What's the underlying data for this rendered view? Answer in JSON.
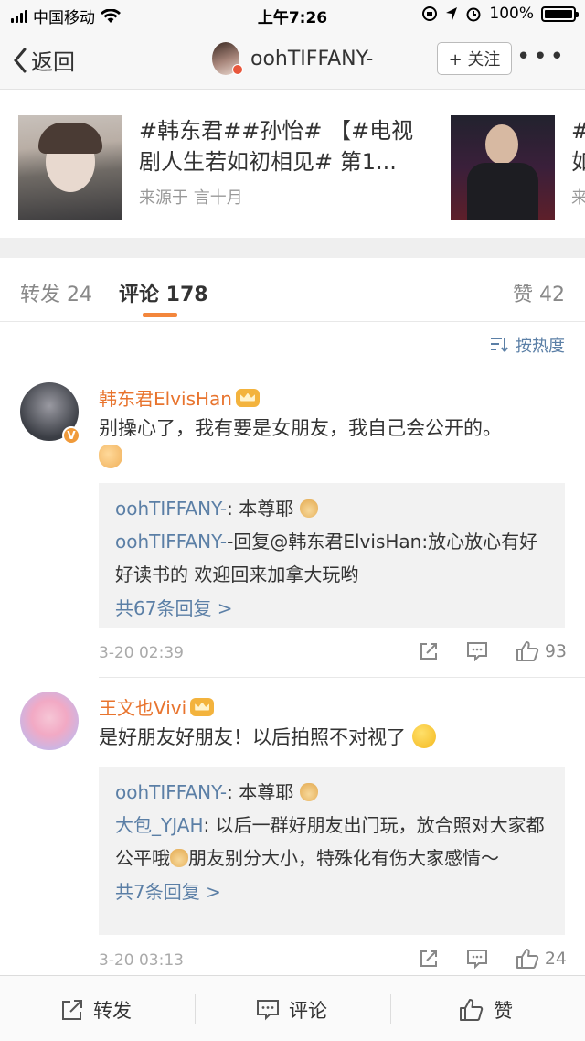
{
  "status_bar": {
    "carrier": "中国移动",
    "time": "上午7:26",
    "battery": "100%",
    "battery_level": 1.0
  },
  "nav": {
    "back_label": "返回",
    "title": "oohTIFFANY-",
    "follow_label": "+ 关注",
    "more_label": "•••"
  },
  "related": [
    {
      "title": "#韩东君##孙怡# 【#电视剧人生若如初相见# 第1...",
      "source": "来源于 言十月"
    },
    {
      "title": "#",
      "title2": "如",
      "source": "来"
    }
  ],
  "tabs": {
    "repost": "转发 24",
    "comment": "评论 178",
    "like": "赞 42"
  },
  "sort_label": "按热度",
  "comments": [
    {
      "name": "韩东君ElvisHan",
      "text": "别操心了，我有要是女朋友，我自己会公开的。",
      "replies": [
        {
          "user": "oohTIFFANY-",
          "text": ": 本尊耶"
        },
        {
          "user": "oohTIFFANY-",
          "text": "-回复@韩东君ElvisHan:放心放心有好好读书的 欢迎回来加拿大玩哟"
        }
      ],
      "more_replies": "共67条回复 >",
      "time": "3-20 02:39",
      "likes": "93"
    },
    {
      "name": "王文也Vivi",
      "text": "是好朋友好朋友！以后拍照不对视了",
      "replies": [
        {
          "user": "oohTIFFANY-",
          "text": ": 本尊耶"
        },
        {
          "user": "大包_YJAH",
          "text": ": 以后一群好朋友出门玩，放合照对大家都公平哦",
          "text2": "朋友别分大小，特殊化有伤大家感情～"
        }
      ],
      "more_replies": "共7条回复 >",
      "time": "3-20 03:13",
      "likes": "24"
    }
  ],
  "bottom_bar": {
    "repost": "转发",
    "comment": "评论",
    "like": "赞"
  }
}
